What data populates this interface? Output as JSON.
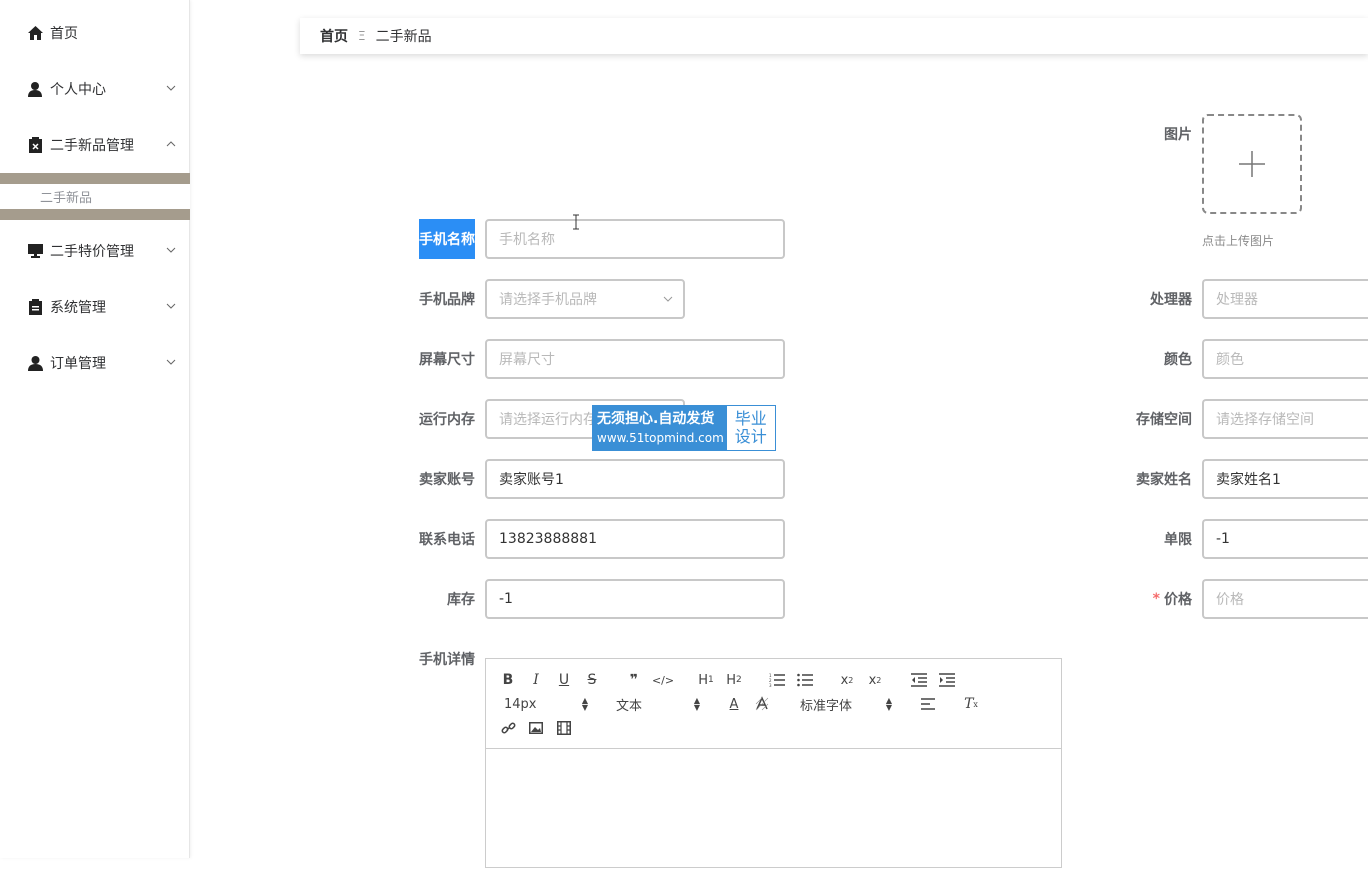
{
  "sidebar": {
    "items": [
      {
        "label": "首页",
        "icon": "home-icon"
      },
      {
        "label": "个人中心",
        "icon": "user-icon"
      },
      {
        "label": "二手新品管理",
        "icon": "clipboard-icon"
      },
      {
        "label": "二手特价管理",
        "icon": "monitor-icon"
      },
      {
        "label": "系统管理",
        "icon": "document-icon"
      },
      {
        "label": "订单管理",
        "icon": "user-icon"
      }
    ],
    "submenu": {
      "label": "二手新品"
    }
  },
  "breadcrumb": {
    "home": "首页",
    "separator": "Ξ",
    "current": "二手新品"
  },
  "form": {
    "image_label": "图片",
    "upload_hint": "点击上传图片",
    "phone_name": {
      "label": "手机名称",
      "placeholder": "手机名称"
    },
    "phone_brand": {
      "label": "手机品牌",
      "placeholder": "请选择手机品牌"
    },
    "processor": {
      "label": "处理器",
      "placeholder": "处理器"
    },
    "screen_size": {
      "label": "屏幕尺寸",
      "placeholder": "屏幕尺寸"
    },
    "color": {
      "label": "颜色",
      "placeholder": "颜色"
    },
    "ram": {
      "label": "运行内存",
      "placeholder": "请选择运行内存"
    },
    "storage": {
      "label": "存储空间",
      "placeholder": "请选择存储空间"
    },
    "seller_account": {
      "label": "卖家账号",
      "value": "卖家账号1"
    },
    "seller_name": {
      "label": "卖家姓名",
      "value": "卖家姓名1"
    },
    "phone": {
      "label": "联系电话",
      "value": "13823888881"
    },
    "limit": {
      "label": "单限",
      "value": "-1"
    },
    "stock": {
      "label": "库存",
      "value": "-1"
    },
    "price": {
      "label": "价格",
      "required_mark": "*",
      "placeholder": "价格"
    },
    "details": {
      "label": "手机详情"
    }
  },
  "editor": {
    "font_size": "14px",
    "text_type": "文本",
    "font_family": "标准字体"
  },
  "watermark": {
    "line1": "无须担心.自动发货",
    "line2": "www.51topmind.com",
    "right1": "毕业",
    "right2": "设计"
  },
  "colors": {
    "accent": "#2b8ef5",
    "submenu_bar": "#a59c8d",
    "watermark": "#3a8fd6"
  }
}
